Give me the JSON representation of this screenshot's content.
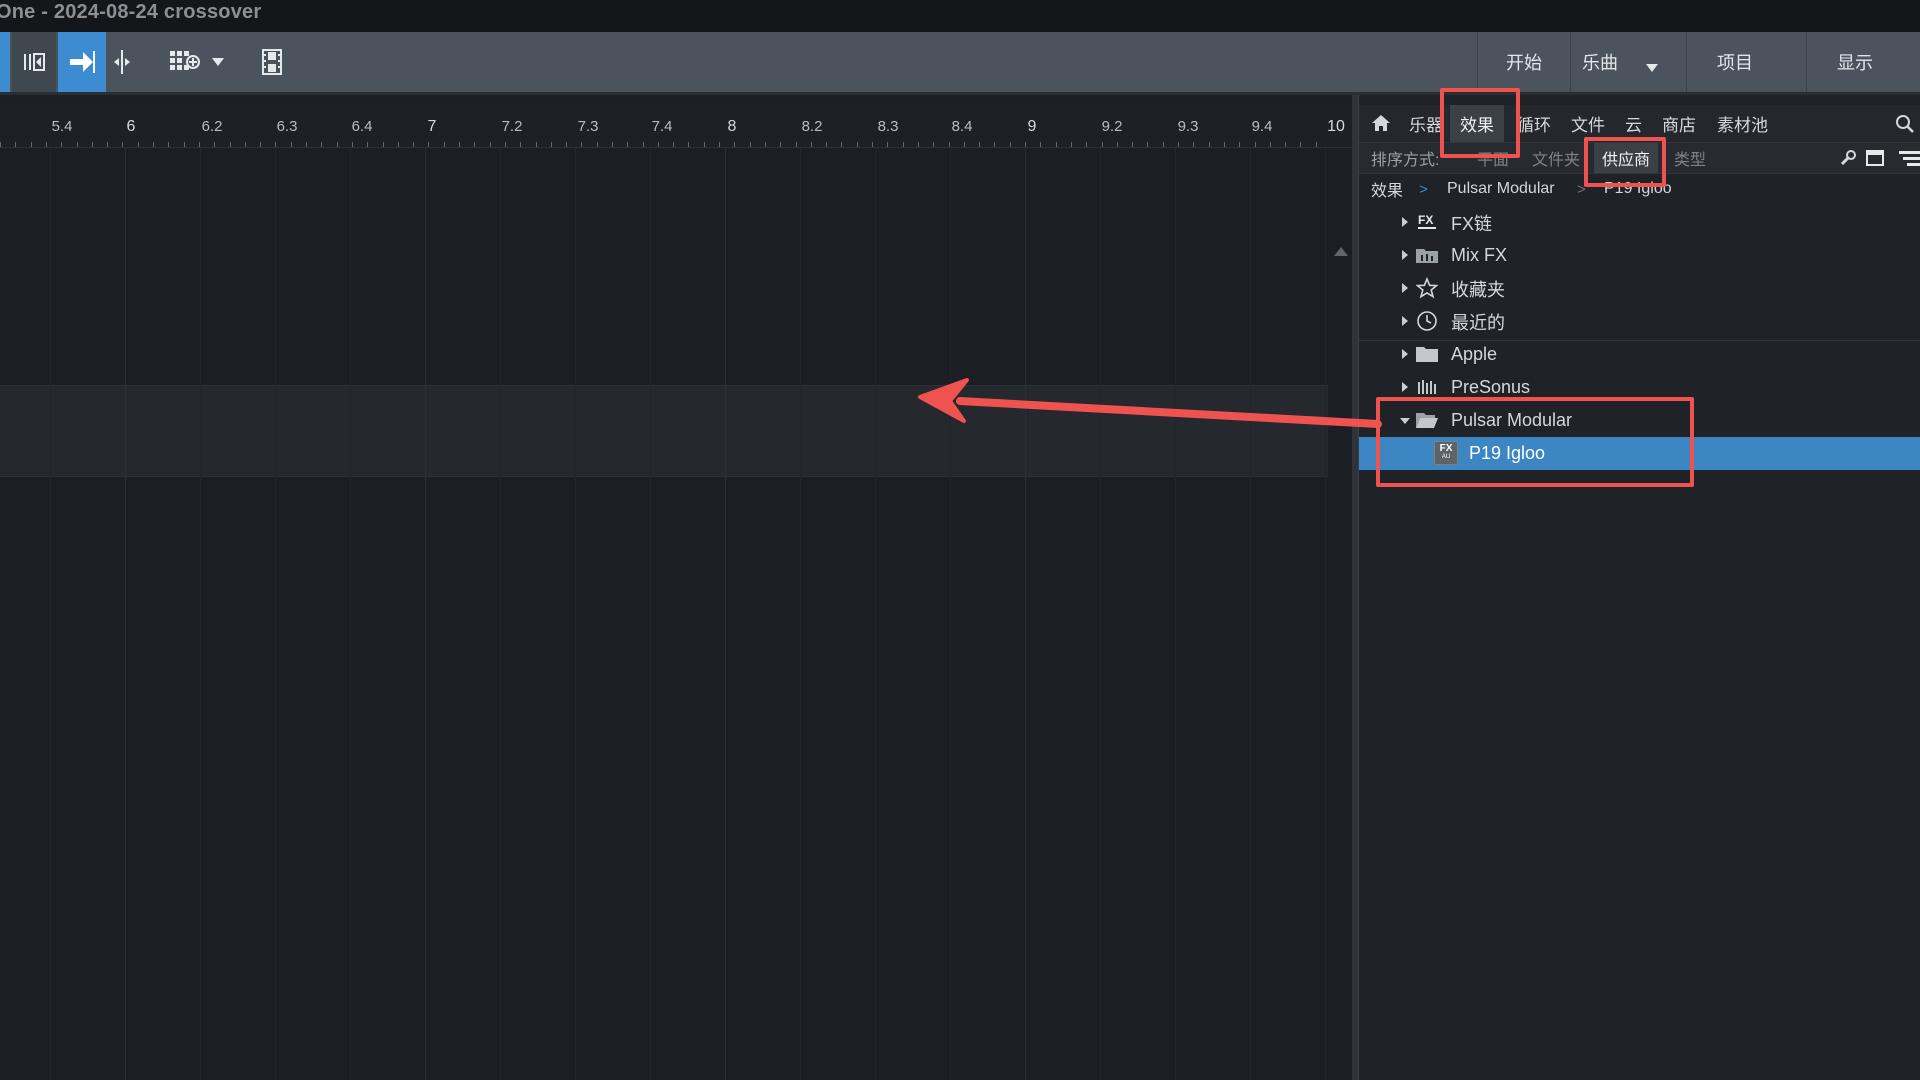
{
  "window": {
    "title": "One - 2024-08-24 crossover"
  },
  "toolbar": {
    "nav": [
      {
        "label": "开始"
      },
      {
        "label": "乐曲"
      },
      {
        "label": "项目"
      },
      {
        "label": "显示"
      }
    ]
  },
  "ruler": {
    "ticks": [
      "5.4",
      "6",
      "6.2",
      "6.3",
      "6.4",
      "7",
      "7.2",
      "7.3",
      "7.4",
      "8",
      "8.2",
      "8.3",
      "8.4",
      "9",
      "9.2",
      "9.3",
      "9.4",
      "10"
    ]
  },
  "browser": {
    "tabs": [
      {
        "label": "乐器"
      },
      {
        "label": "效果"
      },
      {
        "label": "循环"
      },
      {
        "label": "文件"
      },
      {
        "label": "云"
      },
      {
        "label": "商店"
      },
      {
        "label": "素材池"
      }
    ],
    "active_tab": "效果",
    "sort": {
      "label": "排序方式:",
      "options": [
        "平面",
        "文件夹",
        "供应商",
        "类型"
      ],
      "active": "供应商"
    },
    "breadcrumb": [
      "效果",
      "Pulsar Modular",
      "P19 Igloo"
    ],
    "tree": [
      {
        "label": "FX链",
        "icon": "fx-chain-icon",
        "expanded": false
      },
      {
        "label": "Mix FX",
        "icon": "mix-fx-folder-icon",
        "expanded": false
      },
      {
        "label": "收藏夹",
        "icon": "star-icon",
        "expanded": false
      },
      {
        "label": "最近的",
        "icon": "clock-icon",
        "expanded": false
      },
      {
        "label": "Apple",
        "icon": "folder-icon",
        "expanded": false
      },
      {
        "label": "PreSonus",
        "icon": "presonus-icon",
        "expanded": false
      },
      {
        "label": "Pulsar Modular",
        "icon": "folder-open-icon",
        "expanded": true
      },
      {
        "label": "P19 Igloo",
        "icon": "fx-au-icon",
        "selected": true
      }
    ]
  },
  "annotation": {
    "color": "#ef5350"
  }
}
